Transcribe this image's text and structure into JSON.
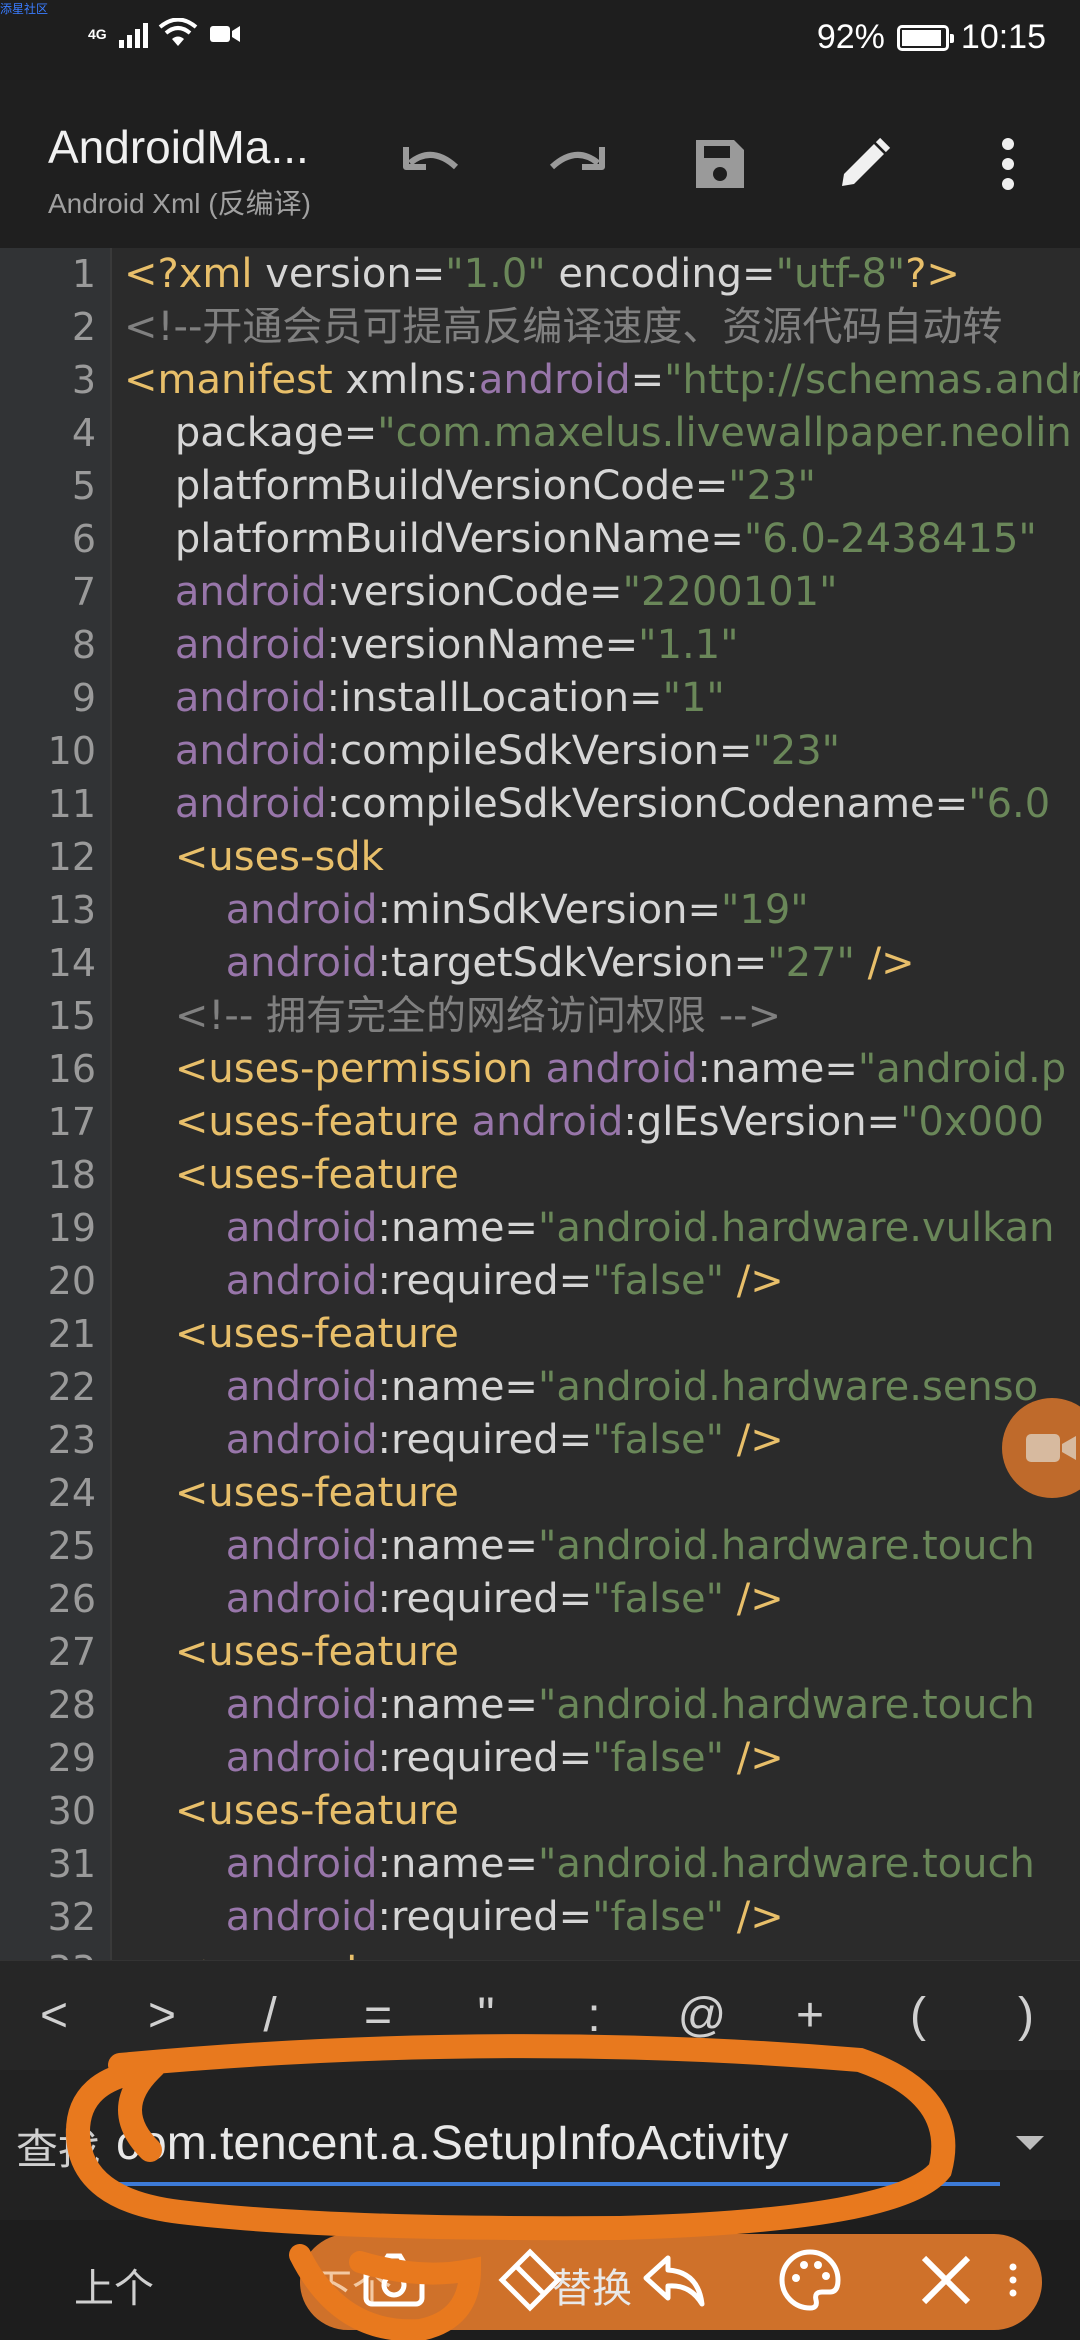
{
  "status_bar": {
    "corner_tag": "添星社区",
    "network": "4G",
    "battery_percent_text": "92%",
    "battery_fill": 0.92,
    "time": "10:15"
  },
  "toolbar": {
    "title": "AndroidMa...",
    "subtitle": "Android Xml (反编译)",
    "icons": [
      "undo-icon",
      "redo-icon",
      "save-icon",
      "edit-icon",
      "more-icon"
    ]
  },
  "editor": {
    "lines": [
      {
        "n": "1",
        "parts": [
          [
            "tag",
            "<?xml "
          ],
          [
            "attr",
            "version="
          ],
          [
            "val",
            "\"1.0\""
          ],
          [
            "attr",
            " encoding="
          ],
          [
            "val",
            "\"utf-8\""
          ],
          [
            "tag",
            "?>"
          ]
        ]
      },
      {
        "n": "2",
        "parts": [
          [
            "cmt",
            "<!--开通会员可提高反编译速度、资源代码自动转"
          ]
        ]
      },
      {
        "n": "3",
        "parts": [
          [
            "tag",
            "<manifest "
          ],
          [
            "attr",
            "xmlns:"
          ],
          [
            "ns",
            "android"
          ],
          [
            "punc",
            "="
          ],
          [
            "val",
            "\"http://schemas.andro"
          ]
        ]
      },
      {
        "n": "4",
        "parts": [
          [
            "attr",
            "    package="
          ],
          [
            "val",
            "\"com.maxelus.livewallpaper.neolin"
          ]
        ]
      },
      {
        "n": "5",
        "parts": [
          [
            "attr",
            "    platformBuildVersionCode="
          ],
          [
            "val",
            "\"23\""
          ]
        ]
      },
      {
        "n": "6",
        "parts": [
          [
            "attr",
            "    platformBuildVersionName="
          ],
          [
            "val",
            "\"6.0-2438415\""
          ]
        ]
      },
      {
        "n": "7",
        "parts": [
          [
            "ns",
            "    android"
          ],
          [
            "attr",
            ":versionCode="
          ],
          [
            "val",
            "\"2200101\""
          ]
        ]
      },
      {
        "n": "8",
        "parts": [
          [
            "ns",
            "    android"
          ],
          [
            "attr",
            ":versionName="
          ],
          [
            "val",
            "\"1.1\""
          ]
        ]
      },
      {
        "n": "9",
        "parts": [
          [
            "ns",
            "    android"
          ],
          [
            "attr",
            ":installLocation="
          ],
          [
            "val",
            "\"1\""
          ]
        ]
      },
      {
        "n": "10",
        "parts": [
          [
            "ns",
            "    android"
          ],
          [
            "attr",
            ":compileSdkVersion="
          ],
          [
            "val",
            "\"23\""
          ]
        ]
      },
      {
        "n": "11",
        "parts": [
          [
            "ns",
            "    android"
          ],
          [
            "attr",
            ":compileSdkVersionCodename="
          ],
          [
            "val",
            "\"6.0"
          ]
        ]
      },
      {
        "n": "12",
        "parts": [
          [
            "tag",
            "    <uses-sdk"
          ]
        ]
      },
      {
        "n": "13",
        "parts": [
          [
            "ns",
            "        android"
          ],
          [
            "attr",
            ":minSdkVersion="
          ],
          [
            "val",
            "\"19\""
          ]
        ]
      },
      {
        "n": "14",
        "parts": [
          [
            "ns",
            "        android"
          ],
          [
            "attr",
            ":targetSdkVersion="
          ],
          [
            "val",
            "\"27\""
          ],
          [
            "tag",
            " />"
          ]
        ]
      },
      {
        "n": "15",
        "parts": [
          [
            "cmt",
            "    <!-- 拥有完全的网络访问权限 -->"
          ]
        ]
      },
      {
        "n": "16",
        "parts": [
          [
            "tag",
            "    <uses-permission "
          ],
          [
            "ns",
            "android"
          ],
          [
            "attr",
            ":name="
          ],
          [
            "val",
            "\"android.p"
          ]
        ]
      },
      {
        "n": "17",
        "parts": [
          [
            "tag",
            "    <uses-feature "
          ],
          [
            "ns",
            "android"
          ],
          [
            "attr",
            ":glEsVersion="
          ],
          [
            "val",
            "\"0x000"
          ]
        ]
      },
      {
        "n": "18",
        "parts": [
          [
            "tag",
            "    <uses-feature"
          ]
        ]
      },
      {
        "n": "19",
        "parts": [
          [
            "ns",
            "        android"
          ],
          [
            "attr",
            ":name="
          ],
          [
            "val",
            "\"android.hardware.vulkan"
          ]
        ]
      },
      {
        "n": "20",
        "parts": [
          [
            "ns",
            "        android"
          ],
          [
            "attr",
            ":required="
          ],
          [
            "val",
            "\"false\""
          ],
          [
            "tag",
            " />"
          ]
        ]
      },
      {
        "n": "21",
        "parts": [
          [
            "tag",
            "    <uses-feature"
          ]
        ]
      },
      {
        "n": "22",
        "parts": [
          [
            "ns",
            "        android"
          ],
          [
            "attr",
            ":name="
          ],
          [
            "val",
            "\"android.hardware.senso"
          ]
        ]
      },
      {
        "n": "23",
        "parts": [
          [
            "ns",
            "        android"
          ],
          [
            "attr",
            ":required="
          ],
          [
            "val",
            "\"false\""
          ],
          [
            "tag",
            " />"
          ]
        ]
      },
      {
        "n": "24",
        "parts": [
          [
            "tag",
            "    <uses-feature"
          ]
        ]
      },
      {
        "n": "25",
        "parts": [
          [
            "ns",
            "        android"
          ],
          [
            "attr",
            ":name="
          ],
          [
            "val",
            "\"android.hardware.touch"
          ]
        ]
      },
      {
        "n": "26",
        "parts": [
          [
            "ns",
            "        android"
          ],
          [
            "attr",
            ":required="
          ],
          [
            "val",
            "\"false\""
          ],
          [
            "tag",
            " />"
          ]
        ]
      },
      {
        "n": "27",
        "parts": [
          [
            "tag",
            "    <uses-feature"
          ]
        ]
      },
      {
        "n": "28",
        "parts": [
          [
            "ns",
            "        android"
          ],
          [
            "attr",
            ":name="
          ],
          [
            "val",
            "\"android.hardware.touch"
          ]
        ]
      },
      {
        "n": "29",
        "parts": [
          [
            "ns",
            "        android"
          ],
          [
            "attr",
            ":required="
          ],
          [
            "val",
            "\"false\""
          ],
          [
            "tag",
            " />"
          ]
        ]
      },
      {
        "n": "30",
        "parts": [
          [
            "tag",
            "    <uses-feature"
          ]
        ]
      },
      {
        "n": "31",
        "parts": [
          [
            "ns",
            "        android"
          ],
          [
            "attr",
            ":name="
          ],
          [
            "val",
            "\"android.hardware.touch"
          ]
        ]
      },
      {
        "n": "32",
        "parts": [
          [
            "ns",
            "        android"
          ],
          [
            "attr",
            ":required="
          ],
          [
            "val",
            "\"false\""
          ],
          [
            "tag",
            " />"
          ]
        ]
      },
      {
        "n": "33",
        "parts": [
          [
            "tag",
            "    <supports-screens"
          ]
        ]
      }
    ]
  },
  "symbols": [
    "<",
    ">",
    "/",
    "=",
    "\"",
    ":",
    "@",
    "+",
    "(",
    ")"
  ],
  "search": {
    "label": "查找",
    "value": "com.tencent.a.SetupInfoActivity"
  },
  "actions": {
    "prev": "上个",
    "next": "下个",
    "replace": "替换"
  },
  "overlay": {
    "capsule_icons": [
      "camera-icon",
      "eraser-icon",
      "reply-icon",
      "palette-icon",
      "close-icon"
    ],
    "bubble_icon": "video-camera-icon",
    "accent_color": "#e8791e"
  }
}
